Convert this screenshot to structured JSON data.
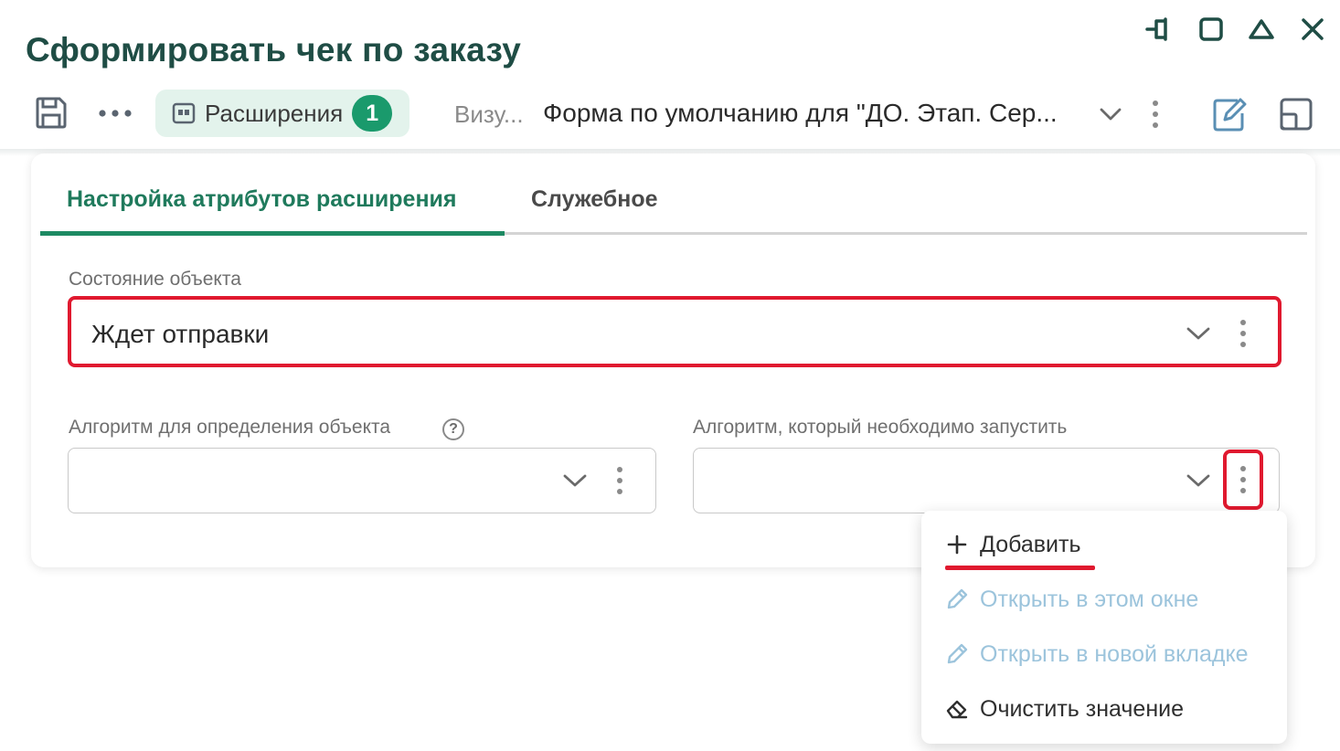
{
  "window": {
    "title": "Сформировать чек по заказу",
    "controls": [
      "pin-icon",
      "maximize-icon",
      "collapse-icon",
      "close-icon"
    ]
  },
  "toolbar": {
    "save_icon": "save-icon",
    "more_icon": "more-horizontal-icon",
    "extensions_label": "Расширения",
    "extensions_count": "1",
    "form_label_short": "Визу...",
    "form_select_value": "Форма по умолчанию для \"ДО. Этап. Сер...",
    "edit_icon": "edit-form-icon",
    "layout_icon": "layout-icon"
  },
  "tabs": [
    {
      "label": "Настройка атрибутов расширения",
      "active": true
    },
    {
      "label": "Служебное",
      "active": false
    }
  ],
  "fields": {
    "object_state": {
      "label": "Состояние объекта",
      "value": "Ждет отправки"
    },
    "algorithm_detect": {
      "label": "Алгоритм для определения объекта",
      "value": ""
    },
    "algorithm_run": {
      "label": "Алгоритм, который необходимо запустить",
      "value": ""
    }
  },
  "context_menu": {
    "items": [
      {
        "label": "Добавить",
        "icon": "plus-icon",
        "enabled": true
      },
      {
        "label": "Открыть в этом окне",
        "icon": "pencil-icon",
        "enabled": false
      },
      {
        "label": "Открыть в новой вкладке",
        "icon": "pencil-icon",
        "enabled": false
      },
      {
        "label": "Очистить значение",
        "icon": "eraser-icon",
        "enabled": true
      }
    ]
  },
  "colors": {
    "accent": "#1d8a63",
    "title": "#1f4d45",
    "highlight": "#e0192f",
    "disabled_text": "#9cc4dc"
  }
}
